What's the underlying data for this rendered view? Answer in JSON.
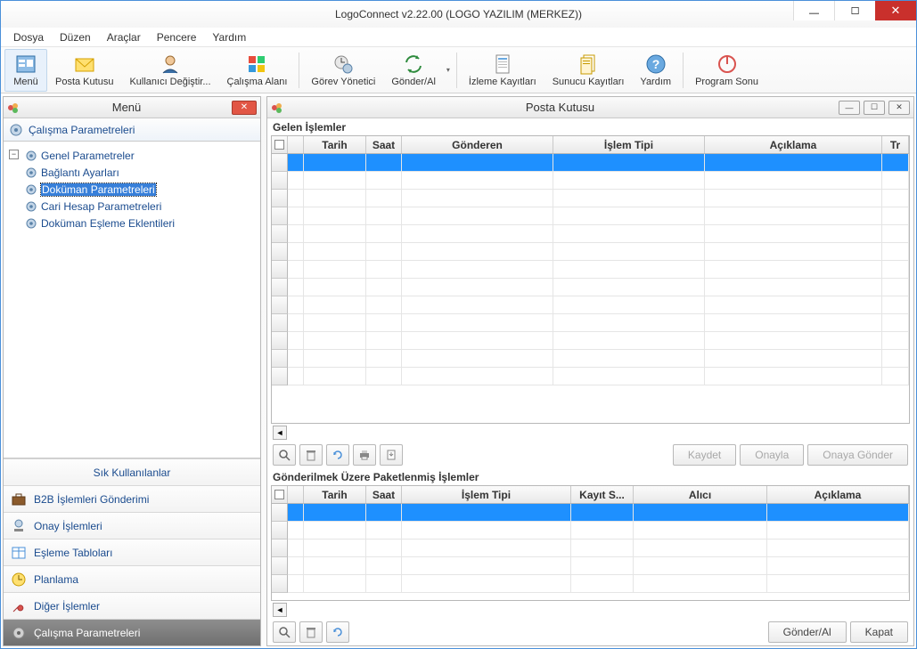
{
  "window": {
    "title": "LogoConnect v2.22.00 (LOGO YAZILIM (MERKEZ))"
  },
  "menubar": [
    "Dosya",
    "Düzen",
    "Araçlar",
    "Pencere",
    "Yardım"
  ],
  "toolbar": {
    "menu": "Menü",
    "posta": "Posta Kutusu",
    "kullanici": "Kullanıcı Değiştir...",
    "calisma": "Çalışma Alanı",
    "gorev": "Görev Yönetici",
    "gonder": "Gönder/Al",
    "izleme": "İzleme Kayıtları",
    "sunucu": "Sunucu Kayıtları",
    "yardim": "Yardım",
    "program": "Program Sonu"
  },
  "menuPanel": {
    "title": "Menü",
    "category": "Çalışma Parametreleri",
    "tree": [
      "Genel Parametreler",
      "Bağlantı Ayarları",
      "Doküman Parametreleri",
      "Cari Hesap Parametreleri",
      "Doküman Eşleme Eklentileri"
    ],
    "treeSelectedIndex": 2,
    "nav": {
      "sik": "Sık Kullanılanlar",
      "b2b": "B2B İşlemleri Gönderimi",
      "onay": "Onay İşlemleri",
      "esleme": "Eşleme Tabloları",
      "plan": "Planlama",
      "diger": "Diğer İşlemler",
      "calisma": "Çalışma Parametreleri"
    }
  },
  "postaPanel": {
    "title": "Posta Kutusu",
    "gelen": {
      "label": "Gelen İşlemler",
      "cols": {
        "tarih": "Tarih",
        "saat": "Saat",
        "gonderen": "Gönderen",
        "tip": "İşlem Tipi",
        "aciklama": "Açıklama",
        "tr": "Tr"
      }
    },
    "buttons": {
      "kaydet": "Kaydet",
      "onayla": "Onayla",
      "onayaGonder": "Onaya Gönder",
      "gonderAl": "Gönder/Al",
      "kapat": "Kapat"
    },
    "paket": {
      "label": "Gönderilmek Üzere Paketlenmiş İşlemler",
      "cols": {
        "tarih": "Tarih",
        "saat": "Saat",
        "tip": "İşlem Tipi",
        "kayit": "Kayıt S...",
        "alici": "Alıcı",
        "aciklama": "Açıklama"
      }
    }
  }
}
